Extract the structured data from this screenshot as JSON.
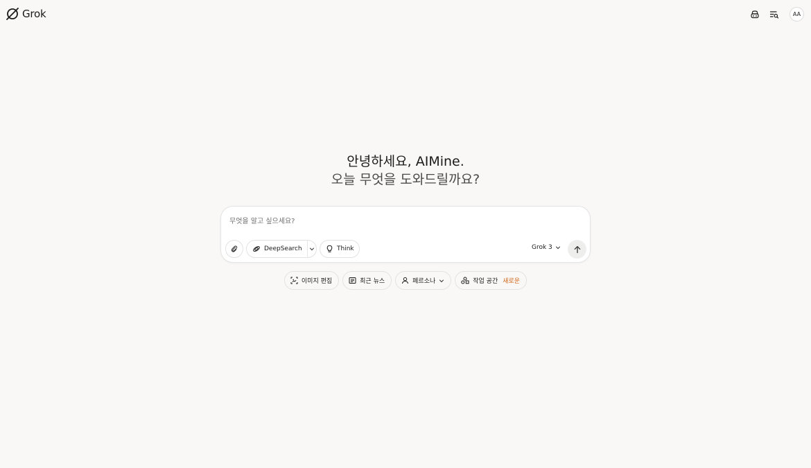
{
  "app": {
    "name": "Grok"
  },
  "header": {
    "avatar_initials": "AA",
    "icons": [
      "incognito-icon",
      "chat-history-icon"
    ]
  },
  "greeting": {
    "line1": "안녕하세요, AIMine.",
    "line2": "오늘 무엇을 도와드릴까요?"
  },
  "composer": {
    "placeholder": "무엇을 알고 싶으세요?",
    "value": "",
    "deepsearch_label": "DeepSearch",
    "think_label": "Think",
    "model_label": "Grok 3"
  },
  "suggestions": [
    {
      "label": "이미지 편집",
      "icon": "image-edit-icon"
    },
    {
      "label": "최근 뉴스",
      "icon": "newspaper-icon"
    },
    {
      "label": "페르소나",
      "icon": "person-icon"
    },
    {
      "label": "작업 공간",
      "icon": "workspace-icon",
      "badge": "새로운"
    }
  ],
  "colors": {
    "background": "#f9f8f6",
    "accent_new": "#d2691e",
    "text": "#1a1a1a"
  }
}
